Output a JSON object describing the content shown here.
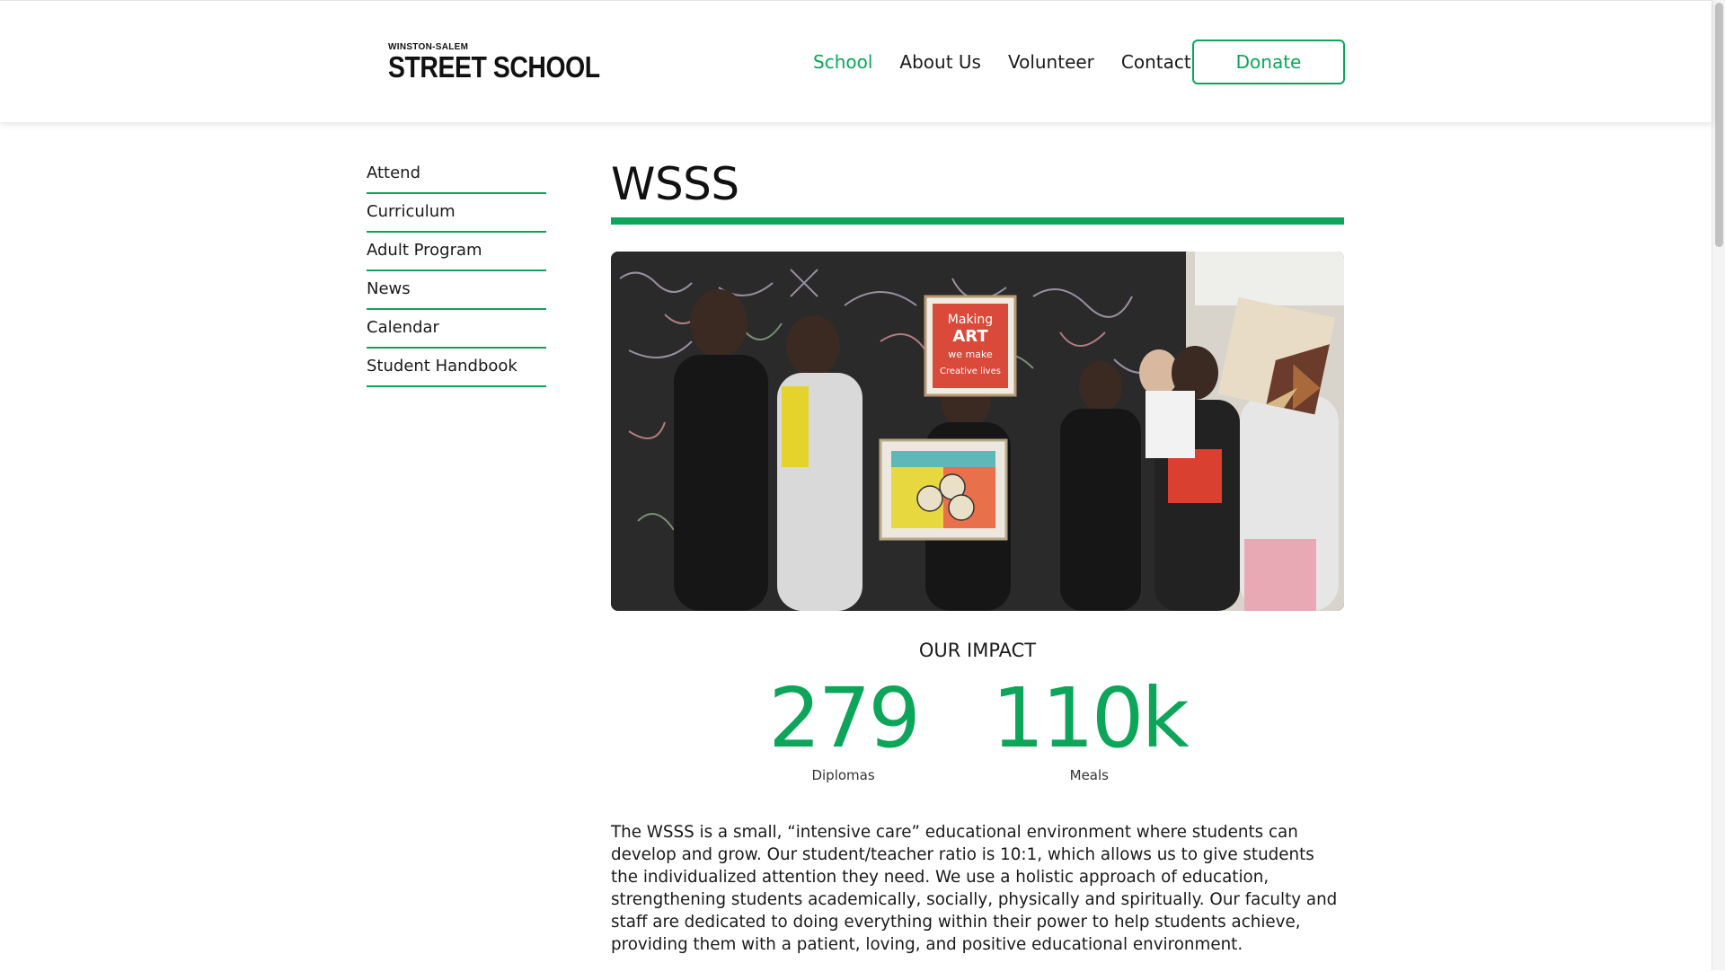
{
  "logo": {
    "small_text": "WINSTON-SALEM",
    "big_text": "STREET SCHOOL"
  },
  "nav": {
    "items": [
      {
        "label": "School",
        "active": true
      },
      {
        "label": "About Us",
        "active": false
      },
      {
        "label": "Volunteer",
        "active": false
      },
      {
        "label": "Contact",
        "active": false
      }
    ],
    "donate_label": "Donate"
  },
  "sidebar": {
    "items": [
      {
        "label": "Attend"
      },
      {
        "label": "Curriculum"
      },
      {
        "label": "Adult Program"
      },
      {
        "label": "News"
      },
      {
        "label": "Calendar"
      },
      {
        "label": "Student Handbook"
      }
    ]
  },
  "main": {
    "title": "WSSS",
    "photo_sign_lines": [
      "Making",
      "ART",
      "we make",
      "Creative lives"
    ],
    "impact_title": "OUR IMPACT",
    "stats": [
      {
        "value": "279",
        "label": "Diplomas"
      },
      {
        "value": "110k",
        "label": "Meals"
      }
    ],
    "description": "The WSSS is a small, “intensive care” educational environment where students can develop and grow. Our student/teacher ratio is 10:1, which allows us to give students the individualized attention they need. We use a holistic approach of education, strengthening students academically, socially, physically and spiritually. Our faculty and staff are dedicated to doing everything within their power to help students achieve, providing them with a patient, loving, and positive educational environment."
  },
  "colors": {
    "accent": "#0ca55a",
    "text": "#1a1a1a"
  }
}
